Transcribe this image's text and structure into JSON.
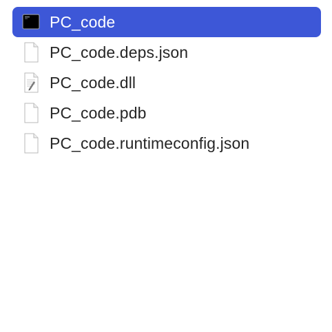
{
  "colors": {
    "selection": "#3d57d7",
    "text": "#262626",
    "selected_text": "#ffffff"
  },
  "files": [
    {
      "name": "PC_code",
      "icon": "terminal-executable-icon",
      "selected": true
    },
    {
      "name": "PC_code.deps.json",
      "icon": "blank-document-icon",
      "selected": false
    },
    {
      "name": "PC_code.dll",
      "icon": "text-document-icon",
      "selected": false
    },
    {
      "name": "PC_code.pdb",
      "icon": "blank-document-icon",
      "selected": false
    },
    {
      "name": "PC_code.runtimeconfig.json",
      "icon": "blank-document-icon",
      "selected": false
    }
  ]
}
